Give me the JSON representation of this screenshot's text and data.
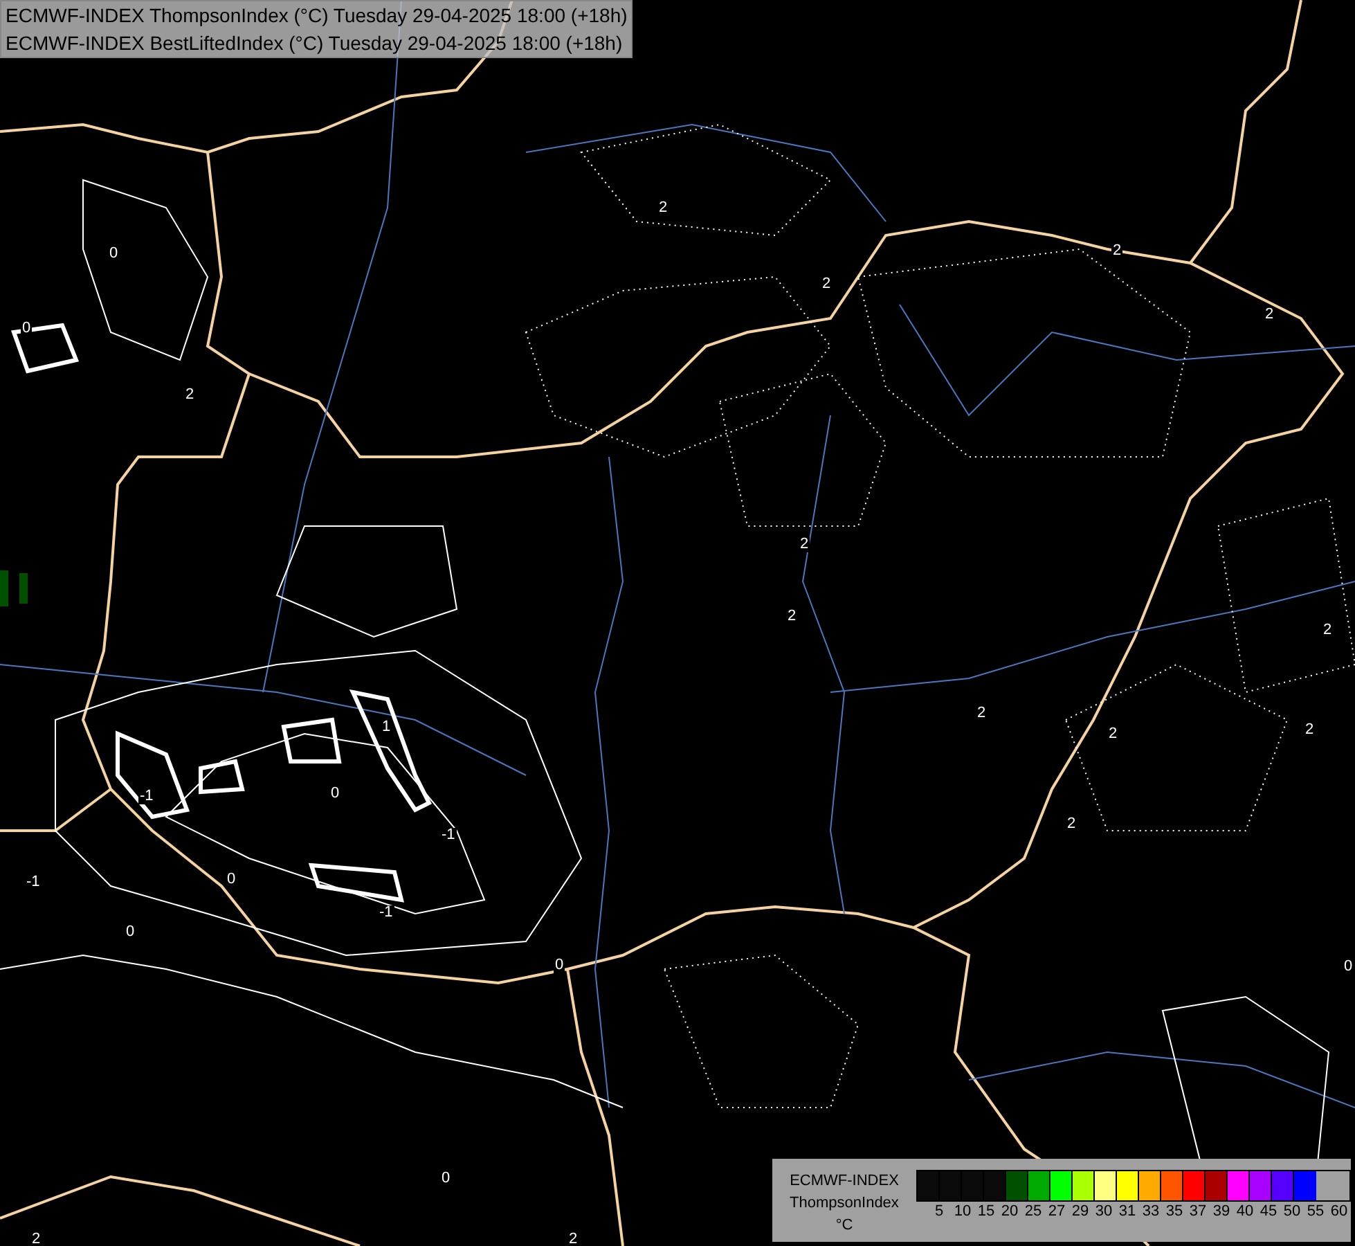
{
  "header": {
    "lines": [
      "ECMWF-INDEX ThompsonIndex (°C) Tuesday 29-04-2025 18:00 (+18h)",
      "ECMWF-INDEX BestLiftedIndex (°C) Tuesday 29-04-2025 18:00 (+18h)"
    ]
  },
  "contour_labels": [
    "0",
    "0",
    "2",
    "2",
    "2",
    "2",
    "2",
    "2",
    "2",
    "2",
    "2",
    "2",
    "2",
    "2",
    "1",
    "0",
    "-1",
    "-1",
    "-1",
    "0",
    "-1",
    "0",
    "0",
    "0",
    "0",
    "2",
    "2"
  ],
  "legend": {
    "title_lines": [
      "ECMWF-INDEX",
      "ThompsonIndex",
      "°C"
    ],
    "swatches": [
      {
        "color": "#0a0a0a"
      },
      {
        "color": "#0a0a0a"
      },
      {
        "color": "#0a0a0a"
      },
      {
        "color": "#0a0a0a"
      },
      {
        "color": "#005000"
      },
      {
        "color": "#00aa00"
      },
      {
        "color": "#00ff00"
      },
      {
        "color": "#aaff00"
      },
      {
        "color": "#ffff80"
      },
      {
        "color": "#ffff00"
      },
      {
        "color": "#ffaa00"
      },
      {
        "color": "#ff5500"
      },
      {
        "color": "#ff0000"
      },
      {
        "color": "#aa0000"
      },
      {
        "color": "#ff00ff"
      },
      {
        "color": "#aa00ff"
      },
      {
        "color": "#5500ff"
      },
      {
        "color": "#0000ff"
      }
    ],
    "ticks": [
      "5",
      "10",
      "15",
      "20",
      "25",
      "27",
      "29",
      "30",
      "31",
      "33",
      "35",
      "37",
      "39",
      "40",
      "45",
      "50",
      "55",
      "60"
    ]
  }
}
